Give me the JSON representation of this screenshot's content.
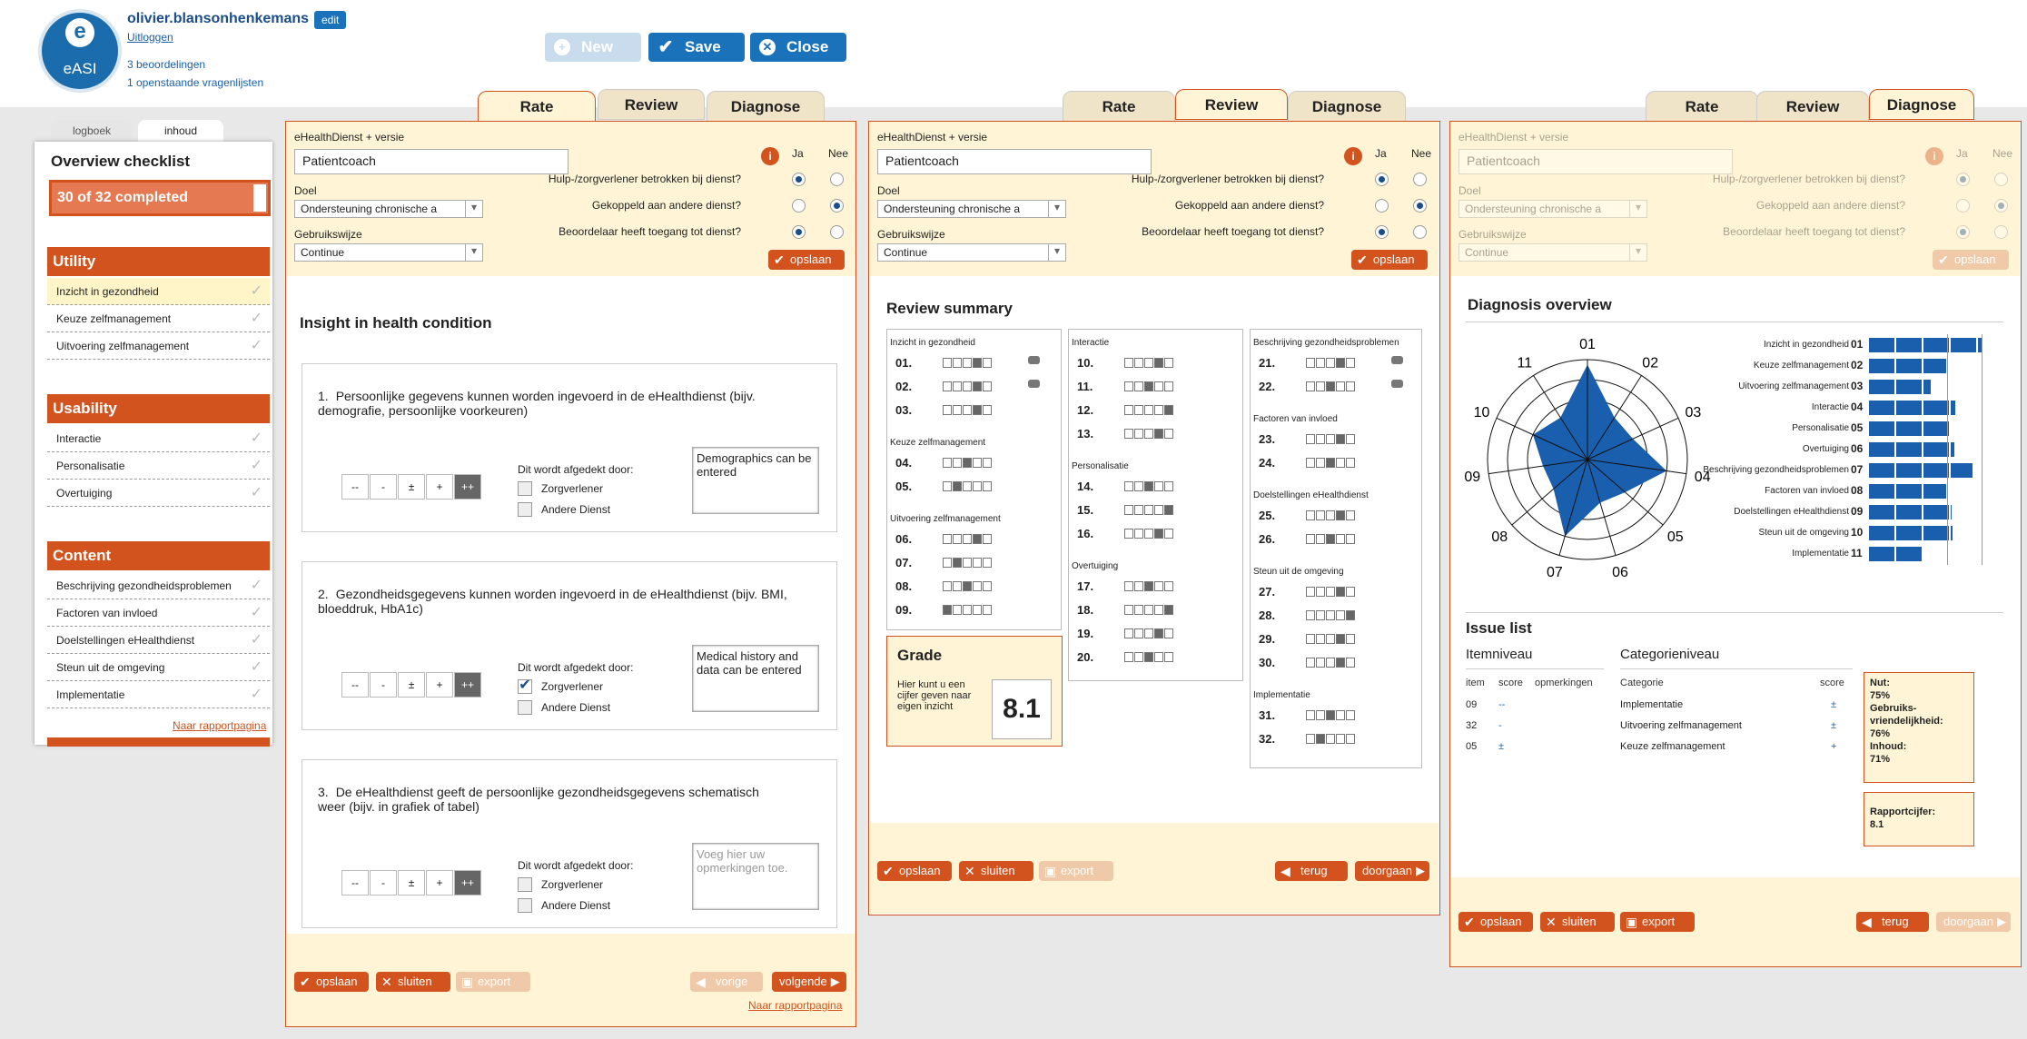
{
  "user": {
    "name": "olivier.blansonhenkemans",
    "edit": "edit",
    "logout": "Uitloggen",
    "reviews": "3 beoordelingen",
    "open": "1 openstaande vragenlijsten",
    "logo": "eASI"
  },
  "toolbar": {
    "new": "New",
    "save": "Save",
    "close": "Close"
  },
  "sidebar": {
    "tab1": "logboek",
    "tab2": "inhoud",
    "title": "Overview checklist",
    "progress": "30 of 32 completed",
    "progress_value": 0.9375,
    "sections": [
      {
        "label": "Utility",
        "items": [
          "Inzicht in gezondheid",
          "Keuze zelfmanagement",
          "Uitvoering zelfmanagement"
        ]
      },
      {
        "label": "Usability",
        "items": [
          "Interactie",
          "Personalisatie",
          "Overtuiging"
        ]
      },
      {
        "label": "Content",
        "items": [
          "Beschrijving gezondheidsproblemen",
          "Factoren van invloed",
          "Doelstellingen eHealthdienst",
          "Steun uit de omgeving",
          "Implementatie"
        ]
      }
    ],
    "report": "Naar rapportpagina"
  },
  "tabs": {
    "rate": "Rate",
    "review": "Review",
    "diagnose": "Diagnose"
  },
  "form": {
    "service_label": "eHealthDienst + versie",
    "service": "Patientcoach",
    "goal_label": "Doel",
    "goal": "Ondersteuning chronische a",
    "usage_label": "Gebruikswijze",
    "usage": "Continue",
    "yes": "Ja",
    "no": "Nee",
    "q1": "Hulp-/zorgverlener betrokken bij dienst?",
    "q2": "Gekoppeld aan andere dienst?",
    "q3": "Beoordelaar heeft toegang tot dienst?",
    "save": "opslaan",
    "info": "i"
  },
  "rate": {
    "title": "Insight in health condition",
    "items": [
      {
        "num": "1.",
        "text": "Persoonlijke gegevens kunnen worden ingevoerd in de eHealthdienst (bijv. demografie, persoonlijke voorkeuren)",
        "comment": "Demographics can be entered",
        "zorg": false,
        "ander": false
      },
      {
        "num": "2.",
        "text": "Gezondheidsgegevens kunnen worden ingevoerd in de eHealthdienst (bijv. BMI, bloeddruk, HbA1c)",
        "comment": "Medical history and data can be entered",
        "zorg": true,
        "ander": false
      },
      {
        "num": "3.",
        "text": "De eHealthdienst geeft de persoonlijke gezondheidsgegevens schematisch weer (bijv. in grafiek of tabel)",
        "comment": "",
        "placeholder": "Voeg hier uw opmerkingen toe.",
        "zorg": false,
        "ander": false
      }
    ],
    "scale": [
      "--",
      "-",
      "±",
      "+",
      "++"
    ],
    "affected": "Dit wordt afgedekt door:",
    "zorg": "Zorgverlener",
    "ander": "Andere Dienst",
    "btn_save": "opslaan",
    "btn_close": "sluiten",
    "btn_export": "export",
    "btn_prev": "vorige",
    "btn_next": "volgende",
    "report": "Naar rapportpagina"
  },
  "review": {
    "title": "Review summary",
    "grade_title": "Grade",
    "grade_text": "Hier kunt u een cijfer geven naar eigen inzicht",
    "grade": "8.1",
    "col1": [
      {
        "g": "Inzicht in gezondheid",
        "rows": [
          [
            "01.",
            4,
            1
          ],
          [
            "02.",
            4,
            1
          ],
          [
            "03.",
            4,
            0
          ]
        ]
      },
      {
        "g": "Keuze zelfmanagement",
        "rows": [
          [
            "04.",
            3,
            0
          ],
          [
            "05.",
            2,
            0
          ]
        ]
      },
      {
        "g": "Uitvoering zelfmanagement",
        "rows": [
          [
            "06.",
            4,
            0
          ],
          [
            "07.",
            2,
            0
          ],
          [
            "08.",
            3,
            0
          ],
          [
            "09.",
            1,
            0
          ]
        ]
      }
    ],
    "col2": [
      {
        "g": "Interactie",
        "rows": [
          [
            "10.",
            4,
            0
          ],
          [
            "11.",
            3,
            0
          ],
          [
            "12.",
            5,
            0
          ],
          [
            "13.",
            4,
            0
          ]
        ]
      },
      {
        "g": "Personalisatie",
        "rows": [
          [
            "14.",
            3,
            0
          ],
          [
            "15.",
            5,
            0
          ],
          [
            "16.",
            4,
            0
          ]
        ]
      },
      {
        "g": "Overtuiging",
        "rows": [
          [
            "17.",
            3,
            0
          ],
          [
            "18.",
            5,
            0
          ],
          [
            "19.",
            4,
            0
          ],
          [
            "20.",
            3,
            0
          ]
        ]
      }
    ],
    "col3": [
      {
        "g": "Beschrijving gezondheidsproblemen",
        "rows": [
          [
            "21.",
            4,
            1
          ],
          [
            "22.",
            3,
            1
          ]
        ]
      },
      {
        "g": "Factoren van invloed",
        "rows": [
          [
            "23.",
            4,
            0
          ],
          [
            "24.",
            3,
            0
          ]
        ]
      },
      {
        "g": "Doelstellingen eHealthdienst",
        "rows": [
          [
            "25.",
            4,
            0
          ],
          [
            "26.",
            3,
            0
          ]
        ]
      },
      {
        "g": "Steun uit de omgeving",
        "rows": [
          [
            "27.",
            4,
            0
          ],
          [
            "28.",
            5,
            0
          ],
          [
            "29.",
            4,
            0
          ],
          [
            "30.",
            4,
            0
          ]
        ]
      },
      {
        "g": "Implementatie",
        "rows": [
          [
            "31.",
            3,
            0
          ],
          [
            "32.",
            2,
            0
          ]
        ]
      }
    ],
    "btn_back": "terug",
    "btn_next": "doorgaan"
  },
  "diagnose": {
    "title": "Diagnosis overview",
    "radar_labels": [
      "01",
      "02",
      "03",
      "04",
      "05",
      "06",
      "07",
      "08",
      "09",
      "10",
      "11"
    ],
    "radar_values": [
      0.95,
      0.5,
      0.5,
      0.8,
      0.5,
      0.45,
      0.8,
      0.45,
      0.45,
      0.6,
      0.5
    ],
    "bars": [
      [
        "Inzicht in gezondheid",
        "01",
        0.95
      ],
      [
        "Keuze zelfmanagement",
        "02",
        0.65
      ],
      [
        "Uitvoering zelfmanagement",
        "03",
        0.52
      ],
      [
        "Interactie",
        "04",
        0.73
      ],
      [
        "Personalisatie",
        "05",
        0.68
      ],
      [
        "Overtuiging",
        "06",
        0.72
      ],
      [
        "Beschrijving gezondheidsproblemen",
        "07",
        0.88
      ],
      [
        "Factoren van invloed",
        "08",
        0.65
      ],
      [
        "Doelstellingen eHealthdienst",
        "09",
        0.7
      ],
      [
        "Steun uit de omgeving",
        "10",
        0.71
      ],
      [
        "Implementatie",
        "11",
        0.45
      ]
    ],
    "issue_title": "Issue list",
    "item_level": "Itemniveau",
    "cat_level": "Categorieniveau",
    "h_item": "item",
    "h_score": "score",
    "h_rem": "opmerkingen",
    "h_cat": "Categorie",
    "h_cscore": "score",
    "items": [
      [
        "09",
        "--"
      ],
      [
        "32",
        "-"
      ],
      [
        "05",
        "±"
      ]
    ],
    "cats": [
      [
        "Implementatie",
        "±"
      ],
      [
        "Uitvoering zelfmanagement",
        "±"
      ],
      [
        "Keuze zelfmanagement",
        "+"
      ]
    ],
    "nut": "Nut:",
    "nut_v": "75%",
    "geb": "Gebruiks-vriendelijkheid:",
    "geb_v": "76%",
    "inh": "Inhoud:",
    "inh_v": "71%",
    "rap": "Rapportcijfer:",
    "rap_v": "8.1"
  },
  "colors": {
    "orange": "#d2531e",
    "blue": "#1a73ba",
    "cream": "#fff5d6"
  }
}
